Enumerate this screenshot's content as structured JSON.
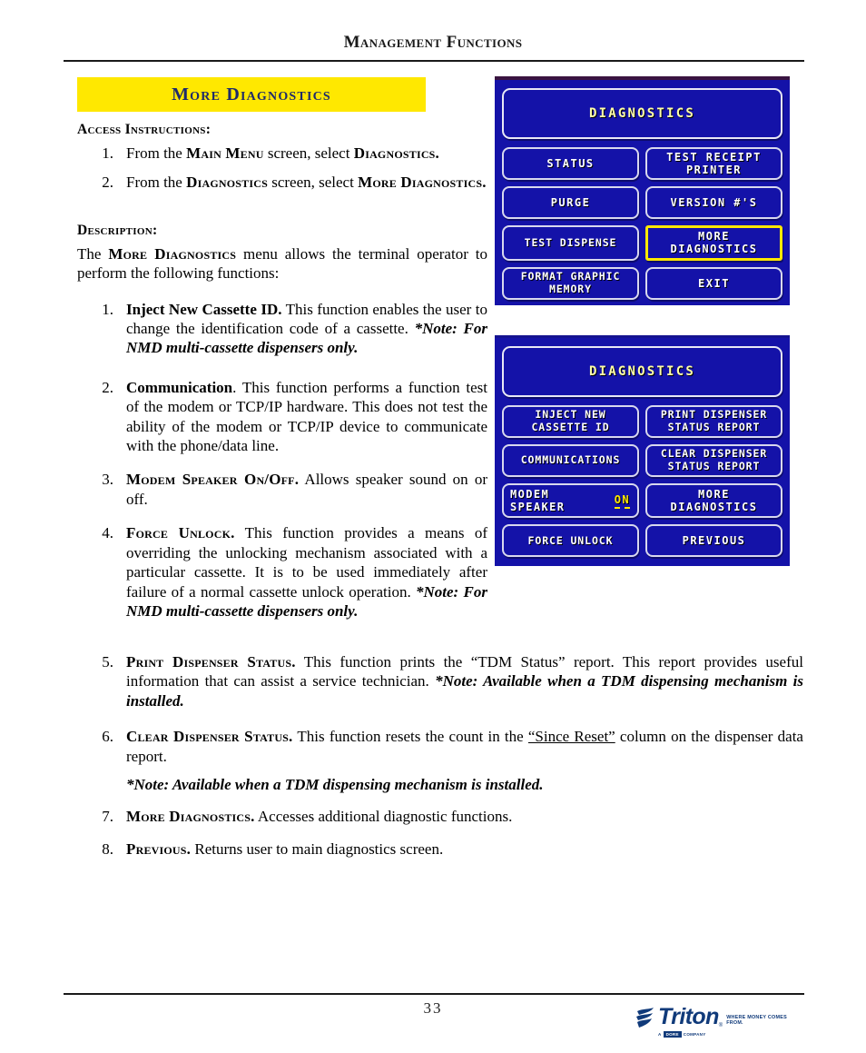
{
  "header": {
    "title": "Management Functions"
  },
  "banner": {
    "label": "More  Diagnostics"
  },
  "access": {
    "heading": "Access Instructions:",
    "steps": [
      {
        "num": "1.",
        "text_before": "From the ",
        "bold1": "Main Menu",
        "text_mid": " screen, select ",
        "bold2": "Diagnostics.",
        "text_after": ""
      },
      {
        "num": "2.",
        "text_before": "From the ",
        "bold1": "Diagnostics",
        "text_mid": " screen, select ",
        "bold2": "More Diagnostics.",
        "text_after": ""
      }
    ]
  },
  "description": {
    "heading": "Description:",
    "intro_before": "The ",
    "intro_bold": "More Diagnostics",
    "intro_after": " menu allows the terminal operator to perform the following functions:",
    "items": [
      {
        "num": "1.",
        "term": "Inject New Cassette ID.",
        "term_style": "bold",
        "body": "  This function enables the user to change the identification code of a cassette. ",
        "note": "*Note: For NMD multi-cassette dispensers only."
      },
      {
        "num": "2.",
        "term": "Communication",
        "term_style": "bold",
        "body": ". This function performs a function test of the modem or TCP/IP hardware. This does not test the ability of the modem or TCP/IP device to communicate with the phone/data line.",
        "note": ""
      },
      {
        "num": "3.",
        "term": "Modem Speaker On/Off.",
        "term_style": "smallcaps",
        "body": "  Allows speaker sound on or off.",
        "note": ""
      },
      {
        "num": "4.",
        "term": "Force Unlock.",
        "term_style": "smallcaps",
        "body": "  This function  provides a means of overriding the unlocking mechanism associated with a particular cassette. It is to be used immediately after failure of a normal cassette unlock operation. ",
        "note": "*Note: For NMD multi-cassette dispensers only."
      }
    ],
    "wide_items": [
      {
        "num": "5.",
        "term": "Print Dispenser Status.",
        "term_style": "smallcaps",
        "body": "  This function prints the “TDM Status” report. This report provides useful information that can assist a service technician. ",
        "note": "*Note: Available when a TDM dispensing mechanism is installed.",
        "sub_note": ""
      },
      {
        "num": "6.",
        "term": "Clear Dispenser Status.",
        "term_style": "smallcaps",
        "body_pre": "  This function resets the count in the ",
        "body_underline": "“Since Reset”",
        "body_post": " column on the dispenser data report.",
        "note": "",
        "sub_note": "*Note: Available when a TDM dispensing mechanism is installed."
      },
      {
        "num": "7.",
        "term": "More Diagnostics.",
        "term_style": "smallcaps",
        "body": "  Accesses additional diagnostic functions.",
        "note": "",
        "sub_note": ""
      },
      {
        "num": "8.",
        "term": "Previous.",
        "term_style": "smallcaps",
        "body": "  Returns user to main diagnostics screen.",
        "note": "",
        "sub_note": ""
      }
    ]
  },
  "atm_screen_1": {
    "title": "DIAGNOSTICS",
    "buttons": [
      {
        "label": "STATUS",
        "highlighted": false
      },
      {
        "label": "TEST RECEIPT\nPRINTER",
        "highlighted": false
      },
      {
        "label": "PURGE",
        "highlighted": false
      },
      {
        "label": "VERSION #'S",
        "highlighted": false
      },
      {
        "label": "TEST DISPENSE",
        "highlighted": false
      },
      {
        "label": "MORE\nDIAGNOSTICS",
        "highlighted": true
      },
      {
        "label": "FORMAT GRAPHIC\nMEMORY",
        "highlighted": false
      },
      {
        "label": "EXIT",
        "highlighted": false
      }
    ]
  },
  "atm_screen_2": {
    "title": "DIAGNOSTICS",
    "buttons": [
      {
        "label": "INJECT NEW\nCASSETTE ID",
        "highlighted": false,
        "value": ""
      },
      {
        "label": "PRINT DISPENSER\nSTATUS REPORT",
        "highlighted": false,
        "value": ""
      },
      {
        "label": "COMMUNICATIONS",
        "highlighted": false,
        "value": ""
      },
      {
        "label": "CLEAR DISPENSER\nSTATUS REPORT",
        "highlighted": false,
        "value": ""
      },
      {
        "label": "MODEM\nSPEAKER",
        "highlighted": false,
        "value": "ON"
      },
      {
        "label": "MORE\nDIAGNOSTICS",
        "highlighted": false,
        "value": ""
      },
      {
        "label": "FORCE UNLOCK",
        "highlighted": false,
        "value": ""
      },
      {
        "label": "PREVIOUS",
        "highlighted": false,
        "value": ""
      }
    ]
  },
  "footer": {
    "page_number": "33",
    "logo_brand": "Triton",
    "logo_tagline": "WHERE MONEY COMES FROM.",
    "logo_chip": "DORE",
    "logo_chip_text": "COMPANY"
  },
  "colors": {
    "banner_bg": "#ffe800",
    "banner_text": "#1d2a6b",
    "screen_bg": "#1412a8",
    "screen_title_text": "#ffffa8",
    "screen_button_text": "#ffffff",
    "highlight": "#ffe800",
    "logo": "#103a7a"
  }
}
